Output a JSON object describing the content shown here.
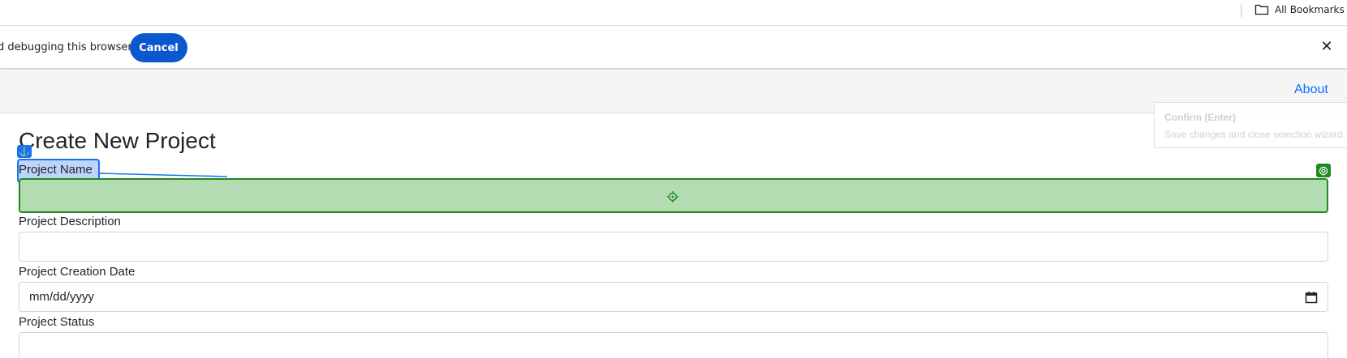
{
  "bookmarks_bar": {
    "all_bookmarks_label": "All Bookmarks",
    "folder_icon": "folder-icon"
  },
  "infobar": {
    "message": "d debugging this browser",
    "cancel_label": "Cancel",
    "close_glyph": "✕",
    "accent_color": "#0b57d0"
  },
  "navbar": {
    "about_label": "About",
    "link_color": "#0d6efd"
  },
  "confirm_tooltip": {
    "title": "Confirm (Enter)",
    "description": "Save changes and close selection wizard."
  },
  "form": {
    "title": "Create New Project",
    "project_name_label": "Project Name",
    "project_name_value": "",
    "project_description_label": "Project Description",
    "project_description_value": "",
    "project_creation_date_label": "Project Creation Date",
    "project_creation_date_placeholder": "mm/dd/yyyy",
    "project_status_label": "Project Status",
    "project_status_value": ""
  },
  "selection_overlay": {
    "anchor_glyph": "⚓",
    "anchor_icon": "anchor-icon",
    "target_icon": "crosshair-icon",
    "highlight_color": "#1a73e8",
    "target_color": "#1e8a1e"
  }
}
